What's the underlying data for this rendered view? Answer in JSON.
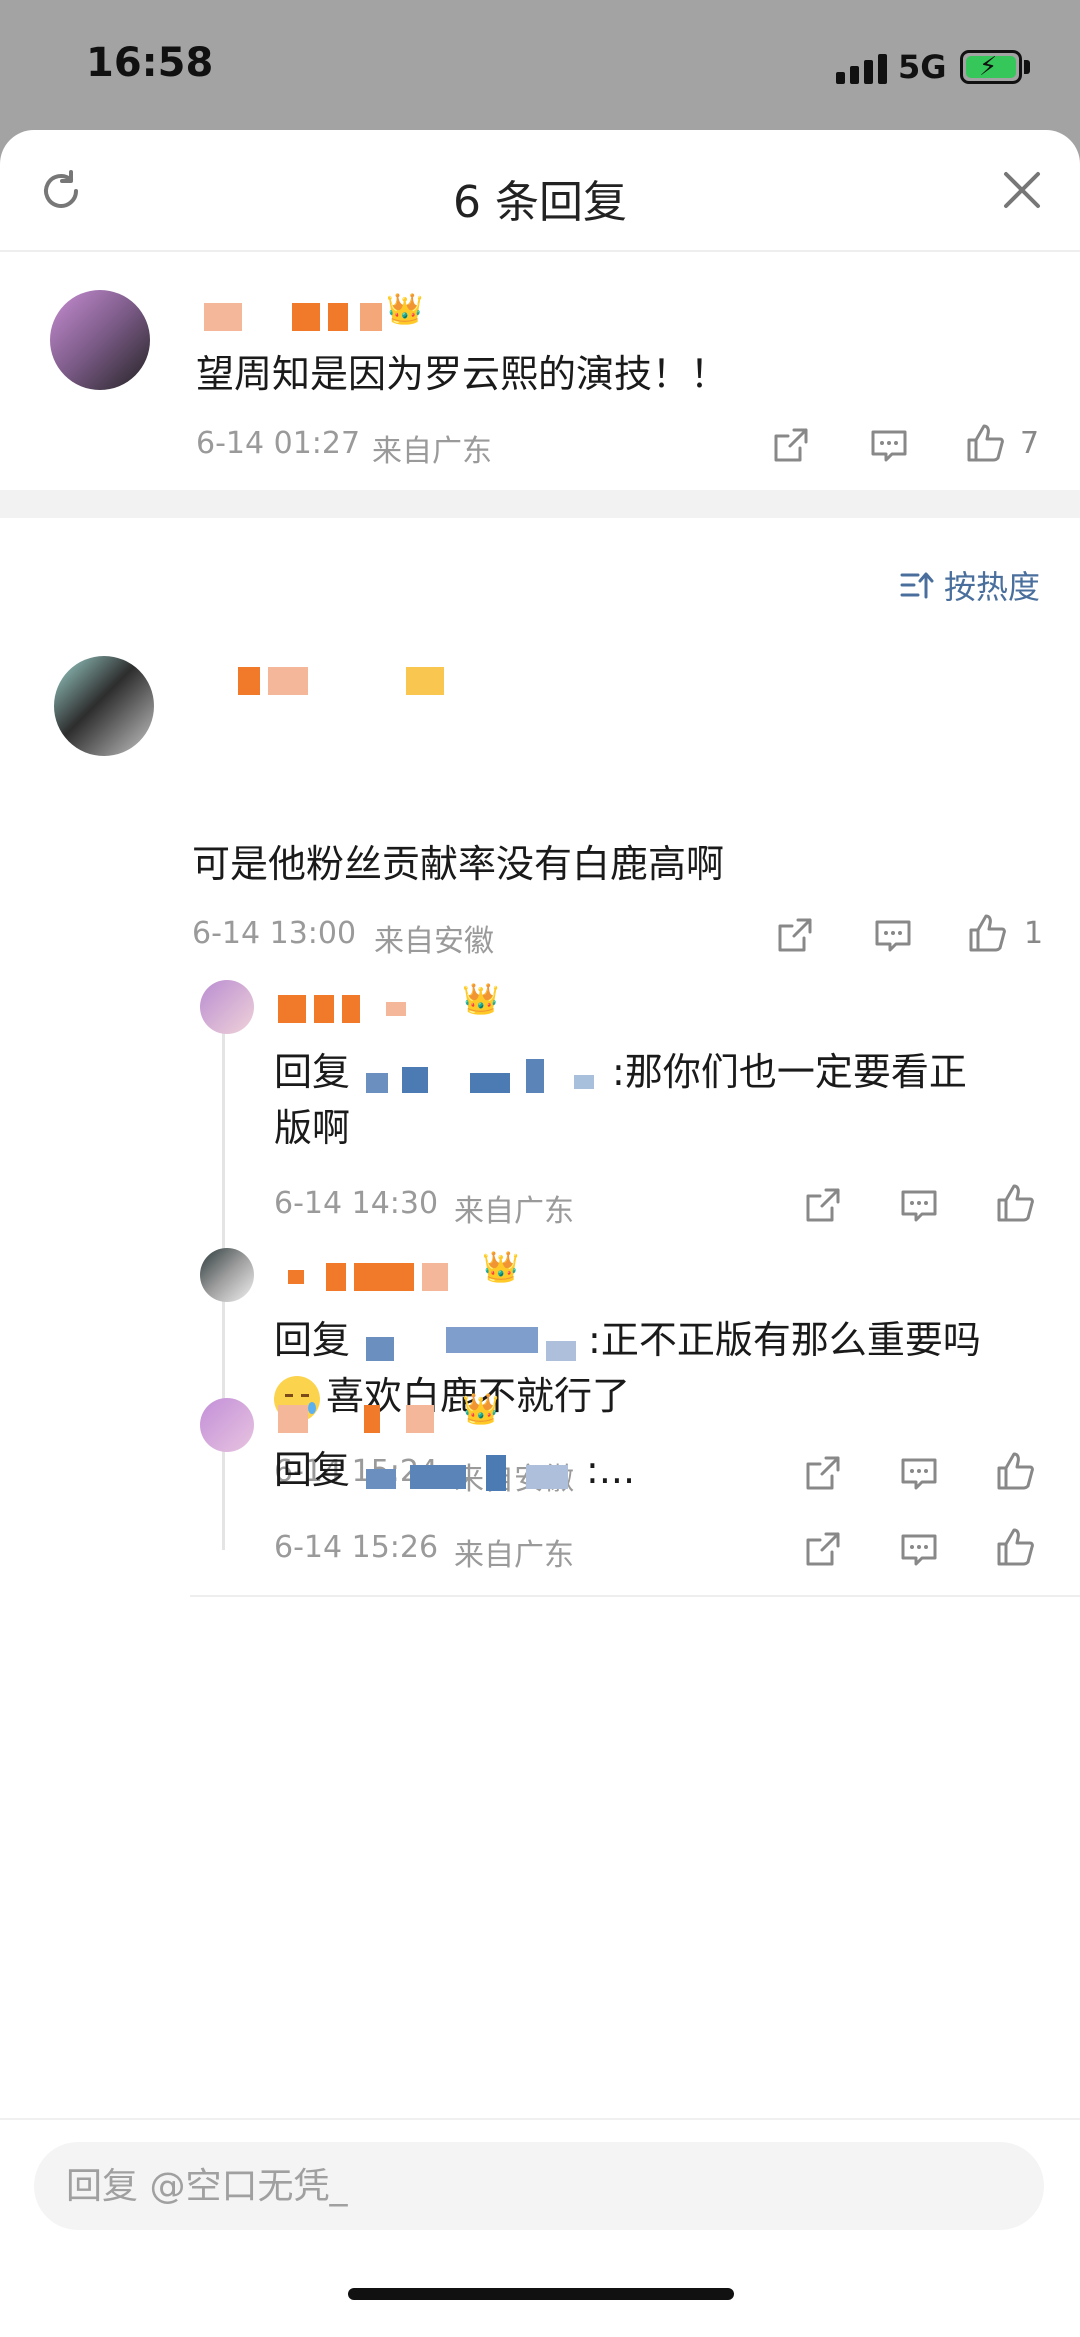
{
  "status_bar": {
    "time": "16:58",
    "network": "5G"
  },
  "header": {
    "title": "6 条回复"
  },
  "root_comment": {
    "text": "望周知是因为罗云熙的演技！！",
    "time": "6-14 01:27",
    "location": "来自广东",
    "like_count": "7"
  },
  "sort": {
    "label": "按热度"
  },
  "thread": {
    "text": "可是他粉丝贡献率没有白鹿高啊",
    "time": "6-14 13:00",
    "location": "来自安徽",
    "like_count": "1",
    "replies": [
      {
        "prefix": "回复",
        "text_line1": ":那你们也一定要看正",
        "text_line2": "版啊",
        "time": "6-14 14:30",
        "location": "来自广东"
      },
      {
        "prefix": "回复",
        "text_line1": ":正不正版有那么重要吗",
        "text_line2": "喜欢白鹿不就行了",
        "time": "6-14 15:24",
        "location": "来自安徽"
      },
      {
        "prefix": "回复",
        "text_line1": ":...",
        "time": "6-14 15:26",
        "location": "来自广东"
      }
    ]
  },
  "reply_input": {
    "placeholder": "回复 @空口无凭_"
  },
  "colors": {
    "link": "#4a6f9c",
    "accent_orange": "#f07a2a",
    "mention_blue": "#5b84b8"
  }
}
